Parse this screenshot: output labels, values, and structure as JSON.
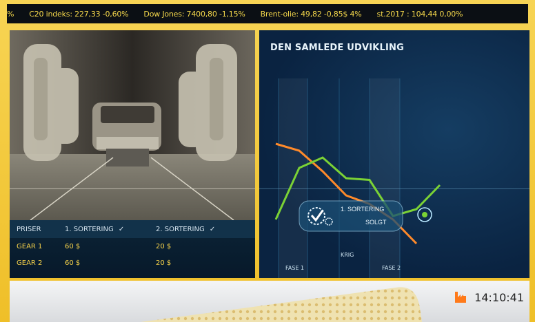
{
  "ticker": [
    "%",
    "C20 indeks: 227,33 -0,60%",
    "Dow Jones: 7400,80 -1,15%",
    "Brent-olie: 49,82 -0,85$ 4%",
    "st.2017 : 104,44 0,00%"
  ],
  "table": {
    "headers": [
      "PRISER",
      "1. SORTERING",
      "2. SORTERING"
    ],
    "rows": [
      {
        "label": "GEAR 1",
        "s1": "60 $",
        "s2": "20 $"
      },
      {
        "label": "GEAR 2",
        "s1": "60 $",
        "s2": "20 $"
      }
    ]
  },
  "chart_data": {
    "type": "line",
    "title": "DEN SAMLEDE UDVIKLING",
    "phases": [
      "FASE 1",
      "KRIG",
      "FASE 2"
    ],
    "series": [
      {
        "color": "#ff8a2a",
        "points": [
          [
            0,
            0.78
          ],
          [
            1,
            0.74
          ],
          [
            2,
            0.62
          ],
          [
            3,
            0.48
          ],
          [
            4,
            0.43
          ],
          [
            5,
            0.34
          ],
          [
            6,
            0.2
          ]
        ]
      },
      {
        "color": "#7bd235",
        "points": [
          [
            0,
            0.34
          ],
          [
            1,
            0.64
          ],
          [
            2,
            0.7
          ],
          [
            3,
            0.58
          ],
          [
            4,
            0.57
          ],
          [
            5,
            0.36
          ],
          [
            6,
            0.4
          ],
          [
            7,
            0.54
          ]
        ]
      }
    ],
    "callout": {
      "title": "1. SORTERING",
      "status": "SOLGT"
    }
  },
  "clock": {
    "time": "14:10:41"
  },
  "colors": {
    "ticker_text": "#f5d84b",
    "accent": "#f0c12d",
    "chart_bg": "#0a2341",
    "orange": "#ff8a2a",
    "green": "#7bd235"
  }
}
